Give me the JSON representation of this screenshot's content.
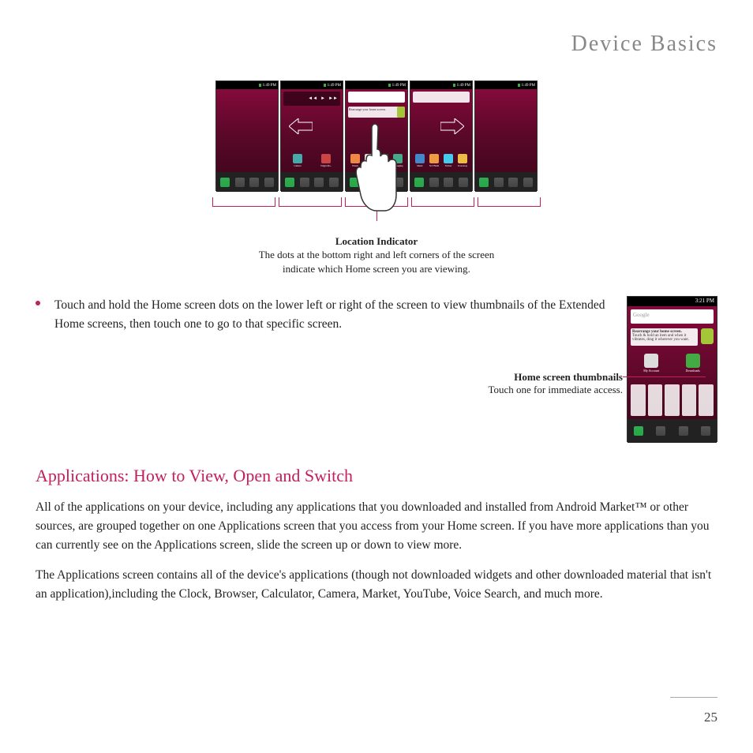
{
  "header": {
    "title": "Device Basics"
  },
  "phones": {
    "status_time": "1:49 PM",
    "screens": [
      {
        "type": "blank"
      },
      {
        "type": "arrow_left",
        "music": {
          "prev": "◄◄",
          "play": "►",
          "next": "►►"
        },
        "apps": [
          {
            "label": "Camera",
            "color": "#4aa"
          },
          {
            "label": "Virgin Mo..",
            "color": "#c44"
          }
        ]
      },
      {
        "type": "center",
        "search": "Google",
        "widget_title": "Rearrange your home screen.",
        "widget_text": "Touch & hold an item and when it vibrates, drag it wherever you want.",
        "apps": [
          {
            "label": "Email",
            "color": "#e84"
          },
          {
            "label": "My Account",
            "color": "#ddd"
          },
          {
            "label": "Downloads",
            "color": "#4a4"
          },
          {
            "label": "Messaging",
            "color": "#4a8"
          }
        ]
      },
      {
        "type": "arrow_right",
        "widget_text": "",
        "apps": [
          {
            "label": "Music",
            "color": "#48c"
          },
          {
            "label": "SCVNGR",
            "color": "#e94"
          },
          {
            "label": "Twitter",
            "color": "#4ce"
          },
          {
            "label": "Scoreloop",
            "color": "#eb4"
          }
        ]
      },
      {
        "type": "blank"
      }
    ]
  },
  "location_indicator": {
    "title": "Location Indicator",
    "desc_line1": "The dots at the bottom right and left corners of the screen",
    "desc_line2": "indicate which Home screen you are viewing."
  },
  "bullet": {
    "text": "Touch and hold the Home screen dots on the lower left or right of the screen to view thumbnails of the Extended Home screens, then touch one to go to that specific screen."
  },
  "thumbnail_phone": {
    "status_time": "3:21 PM",
    "search": "Google",
    "widget_title": "Rearrange your home screen.",
    "widget_text": "Touch & hold an item and when it vibrates, drag it wherever you want.",
    "apps": [
      {
        "label": "My Account",
        "color": "#ddd"
      },
      {
        "label": "Downloads",
        "color": "#4a4"
      }
    ]
  },
  "thumb_callout": {
    "title": "Home screen thumbnails",
    "desc": "Touch one for immediate access."
  },
  "section": {
    "heading": "Applications: How to View, Open and Switch",
    "para1": "All of the applications on your device, including any applications that you downloaded and installed from Android Market™ or other sources, are grouped together on one Applications screen that you access from your Home screen. If you have more applications than you can currently see on the Applications screen, slide the screen up or down to view more.",
    "para2": "The Applications screen contains all of the device's applications (though not downloaded widgets and other downloaded material that isn't an application),including the Clock, Browser, Calculator, Camera, Market, YouTube, Voice Search, and much more."
  },
  "page_number": "25"
}
